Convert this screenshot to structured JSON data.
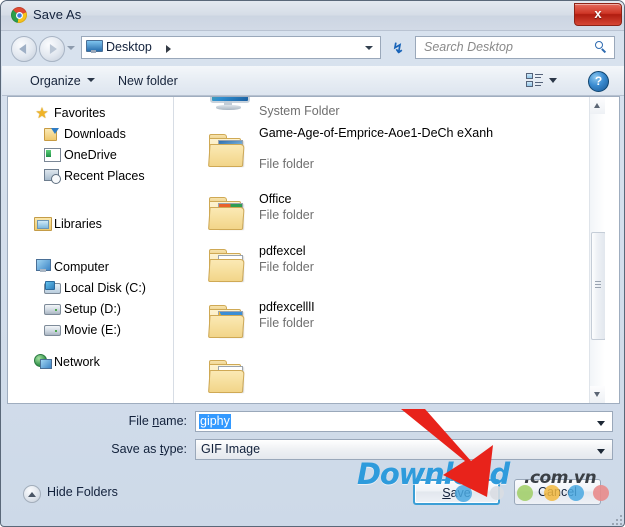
{
  "window": {
    "title": "Save As",
    "title_icon": "chrome-icon",
    "close_label": "x"
  },
  "nav": {
    "back_icon": "back-arrow-icon",
    "forward_icon": "forward-arrow-icon",
    "history_icon": "chevron-down-icon",
    "breadcrumb": "Desktop",
    "breadcrumb_icon": "desktop-monitor-icon",
    "refresh_icon": "refresh-icon",
    "refresh_glyph": "↯",
    "search_placeholder": "Search Desktop",
    "search_value": "",
    "search_icon": "magnifier-icon"
  },
  "toolbar": {
    "organize": "Organize",
    "new_folder": "New folder",
    "view_icon": "view-options-icon",
    "view_caret_icon": "chevron-down-icon",
    "help_label": "?",
    "help_icon": "help-icon"
  },
  "sidebar": {
    "groups": [
      {
        "header": {
          "label": "Favorites",
          "icon": "star-icon"
        },
        "items": [
          {
            "label": "Downloads",
            "icon": "downloads-icon"
          },
          {
            "label": "OneDrive",
            "icon": "onedrive-icon"
          },
          {
            "label": "Recent Places",
            "icon": "recent-places-icon"
          }
        ]
      },
      {
        "header": {
          "label": "Libraries",
          "icon": "libraries-icon"
        },
        "items": []
      },
      {
        "header": {
          "label": "Computer",
          "icon": "computer-icon"
        },
        "items": [
          {
            "label": "Local Disk (C:)",
            "icon": "local-disk-icon"
          },
          {
            "label": "Setup (D:)",
            "icon": "drive-icon"
          },
          {
            "label": "Movie  (E:)",
            "icon": "drive-icon"
          }
        ]
      },
      {
        "header": {
          "label": "Network",
          "icon": "network-icon"
        },
        "items": []
      }
    ]
  },
  "filelist": {
    "items": [
      {
        "name": "",
        "type": "System Folder",
        "icon": "computer-system-icon"
      },
      {
        "name": "Game-Age-of-Emprice-Aoe1-DeCh eXanh",
        "type": "File folder",
        "icon": "folder-icon"
      },
      {
        "name": "Office",
        "type": "File folder",
        "icon": "folder-icon"
      },
      {
        "name": "pdfexcel",
        "type": "File folder",
        "icon": "folder-icon"
      },
      {
        "name": "pdfexcelllI",
        "type": "File folder",
        "icon": "folder-icon"
      },
      {
        "name": "",
        "type": "",
        "icon": "folder-icon"
      }
    ],
    "scrollbar": {
      "up_icon": "scroll-up-arrow-icon",
      "down_icon": "scroll-down-arrow-icon",
      "thumb_icon": "scroll-thumb"
    }
  },
  "form": {
    "filename_label": "File name:",
    "filename_label_pre": "File ",
    "filename_label_accel": "n",
    "filename_label_post": "ame:",
    "filename_value": "giphy",
    "savetype_label": "Save as type:",
    "savetype_label_pre": "Save as ",
    "savetype_label_accel": "t",
    "savetype_label_post": "ype:",
    "savetype_value": "GIF Image",
    "caret_icon": "chevron-down-icon"
  },
  "footer": {
    "hide_folders": "Hide Folders",
    "hide_folders_icon": "collapse-up-icon",
    "save_pre": "",
    "save_accel": "S",
    "save_post": "ave",
    "save_label": "Save",
    "cancel_label": "Cancel",
    "resize_grip_icon": "resize-grip-icon"
  },
  "overlay": {
    "watermark_main": "Download",
    "watermark_suffix": ".com.vn",
    "watermark_color": "#2e9bdc",
    "arrow_icon": "red-pointer-arrow",
    "arrow_color": "#e8231b"
  }
}
